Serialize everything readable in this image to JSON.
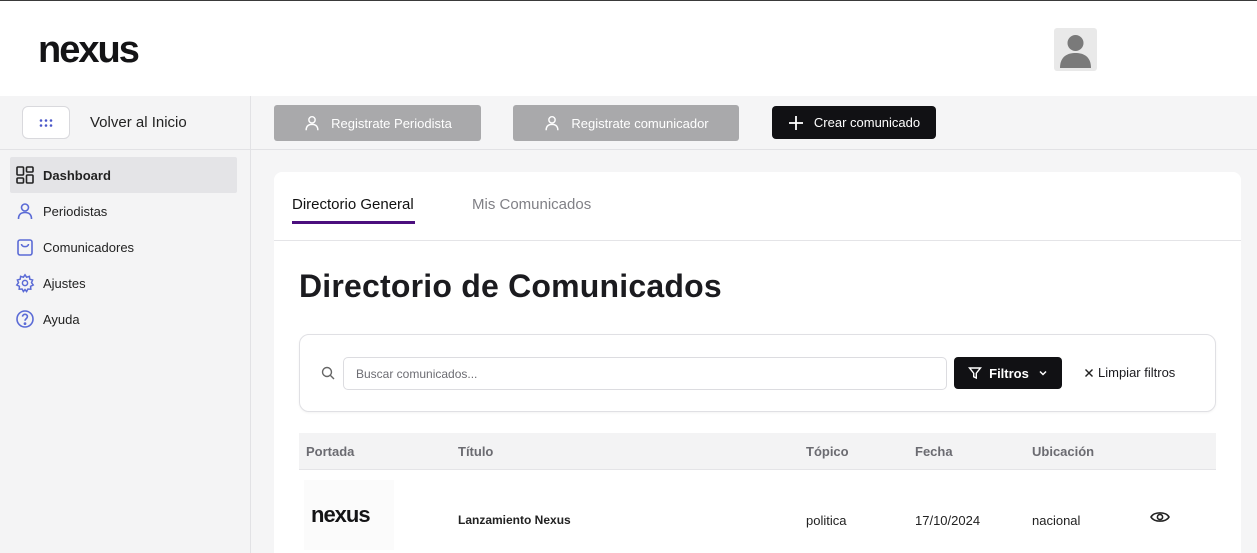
{
  "header": {
    "logo_text": "nexus",
    "avatar_alt": "user-avatar"
  },
  "sidebar": {
    "back_label": "Volver al Inicio",
    "items": [
      {
        "label": "Dashboard",
        "icon": "dashboard-icon",
        "active": true
      },
      {
        "label": "Periodistas",
        "icon": "user-icon",
        "active": false
      },
      {
        "label": "Comunicadores",
        "icon": "shopping-bag-icon",
        "active": false
      },
      {
        "label": "Ajustes",
        "icon": "gear-icon",
        "active": false
      },
      {
        "label": "Ayuda",
        "icon": "help-circle-icon",
        "active": false
      }
    ]
  },
  "toolbar": {
    "register_journalist": "Registrate Periodista",
    "register_communicator": "Registrate comunicador",
    "create_release": "Crear comunicado"
  },
  "tabs": [
    {
      "label": "Directorio General",
      "active": true
    },
    {
      "label": "Mis Comunicados",
      "active": false
    }
  ],
  "page_title": "Directorio de Comunicados",
  "search": {
    "placeholder": "Buscar comunicados...",
    "value": "",
    "filters_label": "Filtros",
    "clear_label": "Limpiar filtros"
  },
  "table": {
    "columns": [
      "Portada",
      "Título",
      "Tópico",
      "Fecha",
      "Ubicación"
    ],
    "rows": [
      {
        "cover": "nexus",
        "title": "Lanzamiento Nexus",
        "topic": "politica",
        "date": "17/10/2024",
        "location": "nacional"
      }
    ]
  },
  "colors": {
    "accent": "#4b0f7e",
    "dark_button": "#111114",
    "disabled_button": "#a9a9ab",
    "icon_blue": "#5b6bd6"
  }
}
